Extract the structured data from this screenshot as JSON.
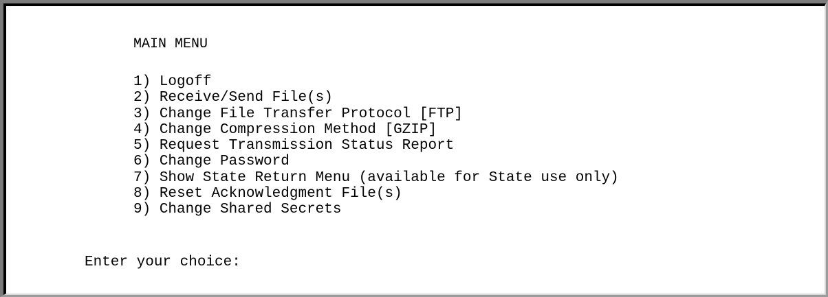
{
  "menu": {
    "title": "MAIN MENU",
    "items": [
      {
        "number": "1)",
        "label": "Logoff"
      },
      {
        "number": "2)",
        "label": "Receive/Send File(s)"
      },
      {
        "number": "3)",
        "label": "Change File Transfer Protocol [FTP]"
      },
      {
        "number": "4)",
        "label": "Change Compression Method [GZIP]"
      },
      {
        "number": "5)",
        "label": "Request Transmission Status Report"
      },
      {
        "number": "6)",
        "label": "Change Password"
      },
      {
        "number": "7)",
        "label": "Show State Return Menu (available for State use only)"
      },
      {
        "number": "8)",
        "label": "Reset Acknowledgment File(s)"
      },
      {
        "number": "9)",
        "label": "Change Shared Secrets"
      }
    ]
  },
  "prompt": {
    "label": "Enter your choice:",
    "value": ""
  }
}
